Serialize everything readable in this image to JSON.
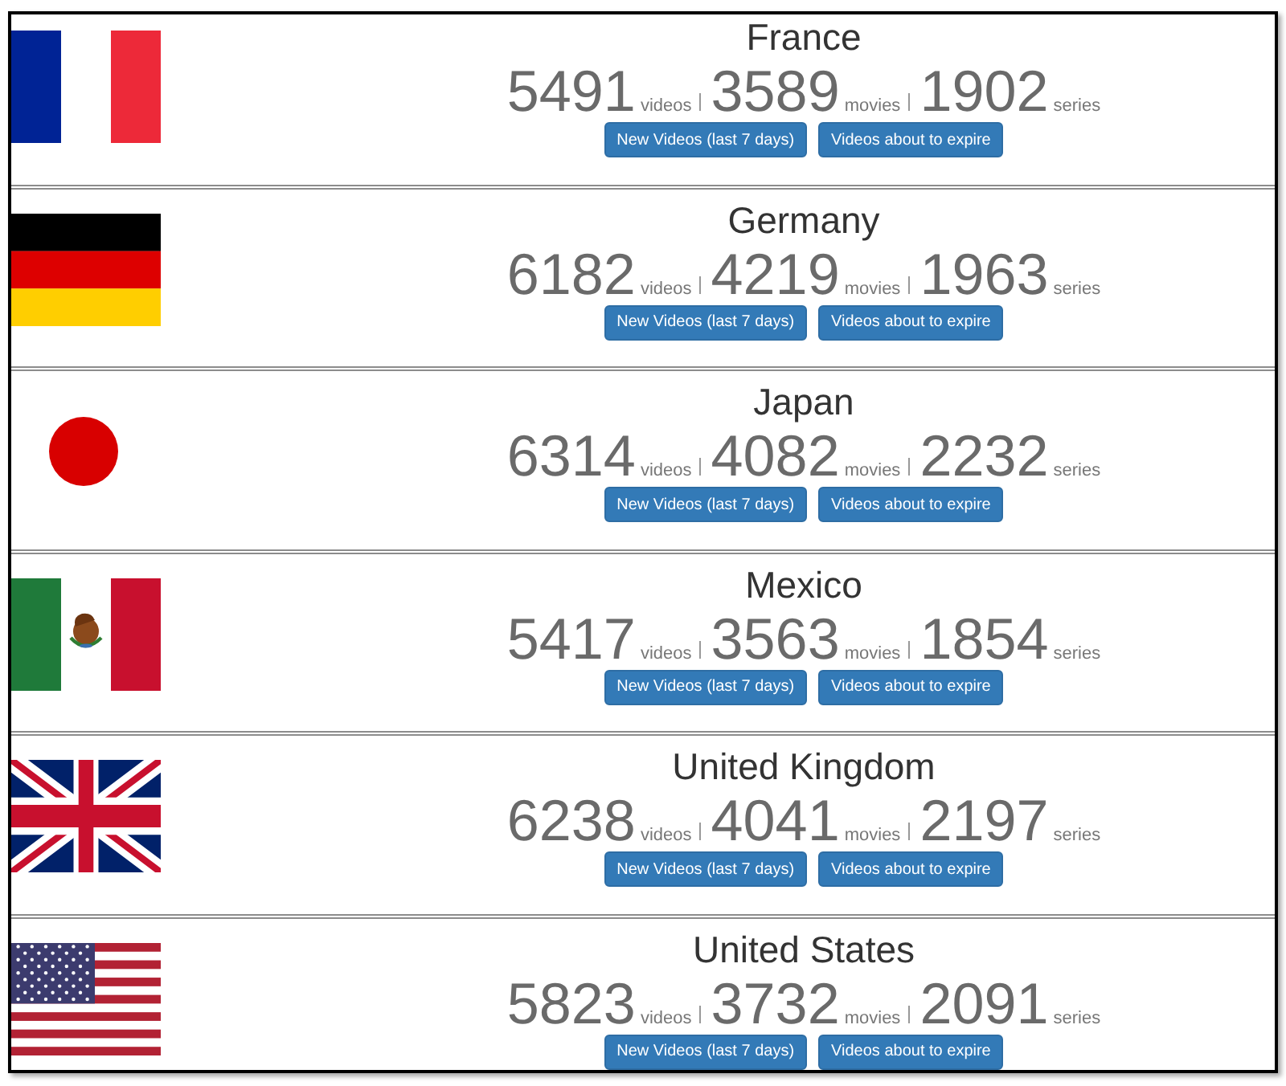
{
  "countries": [
    {
      "kind": "france",
      "name": "France",
      "counts": [
        {
          "value": "5491",
          "unit": "videos"
        },
        {
          "value": "3589",
          "unit": "movies"
        },
        {
          "value": "1902",
          "unit": "series"
        }
      ],
      "buttons": [
        "New Videos (last 7 days)",
        "Videos about to expire"
      ]
    },
    {
      "kind": "germany",
      "name": "Germany",
      "counts": [
        {
          "value": "6182",
          "unit": "videos"
        },
        {
          "value": "4219",
          "unit": "movies"
        },
        {
          "value": "1963",
          "unit": "series"
        }
      ],
      "buttons": [
        "New Videos (last 7 days)",
        "Videos about to expire"
      ]
    },
    {
      "kind": "japan",
      "name": "Japan",
      "counts": [
        {
          "value": "6314",
          "unit": "videos"
        },
        {
          "value": "4082",
          "unit": "movies"
        },
        {
          "value": "2232",
          "unit": "series"
        }
      ],
      "buttons": [
        "New Videos (last 7 days)",
        "Videos about to expire"
      ]
    },
    {
      "kind": "mexico",
      "name": "Mexico",
      "counts": [
        {
          "value": "5417",
          "unit": "videos"
        },
        {
          "value": "3563",
          "unit": "movies"
        },
        {
          "value": "1854",
          "unit": "series"
        }
      ],
      "buttons": [
        "New Videos (last 7 days)",
        "Videos about to expire"
      ]
    },
    {
      "kind": "uk",
      "name": "United Kingdom",
      "counts": [
        {
          "value": "6238",
          "unit": "videos"
        },
        {
          "value": "4041",
          "unit": "movies"
        },
        {
          "value": "2197",
          "unit": "series"
        }
      ],
      "buttons": [
        "New Videos (last 7 days)",
        "Videos about to expire"
      ]
    },
    {
      "kind": "usa",
      "name": "United States",
      "counts": [
        {
          "value": "5823",
          "unit": "videos"
        },
        {
          "value": "3732",
          "unit": "movies"
        },
        {
          "value": "2091",
          "unit": "series"
        }
      ],
      "buttons": [
        "New Videos (last 7 days)",
        "Videos about to expire"
      ]
    }
  ]
}
